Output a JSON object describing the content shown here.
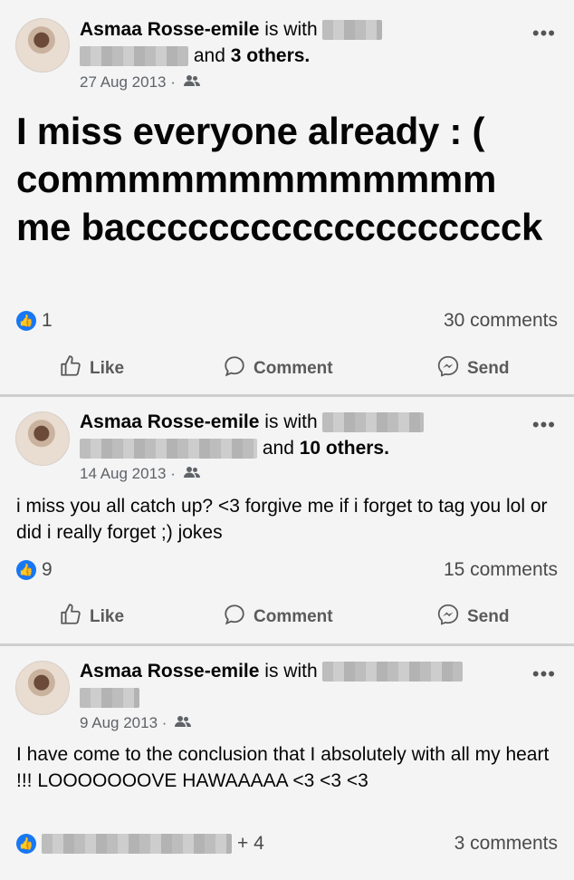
{
  "posts": [
    {
      "author": "Asmaa Rosse-emile",
      "with_text": "is with",
      "and_text": "and",
      "others": "3 others.",
      "date": "27 Aug 2013",
      "text": "I miss everyone already : ( commmmmmmmmmmmm me baccccccccccccccccccck",
      "likes": "1",
      "comments": "30 comments"
    },
    {
      "author": "Asmaa Rosse-emile",
      "with_text": "is with",
      "and_text": "and",
      "others": "10 others.",
      "date": "14 Aug 2013",
      "text": "i miss you all catch up? <3 forgive me if i forget to tag you lol or did i really forget ;) jokes",
      "likes": "9",
      "comments": "15 comments"
    },
    {
      "author": "Asmaa Rosse-emile",
      "with_text": "is with",
      "date": "9 Aug 2013",
      "text": "I have come to the conclusion that I absolutely with all my heart !!! LOOOOOOOVE HAWAAAAA <3 <3 <3",
      "likes_extra": "+ 4",
      "comments": "3 comments"
    }
  ],
  "actions": {
    "like": "Like",
    "comment": "Comment",
    "send": "Send"
  },
  "more": "•••",
  "date_separator": " · ",
  "icons": {
    "like": "thumbs-up-icon",
    "comment": "comment-icon",
    "send": "messenger-icon",
    "audience": "friends-icon"
  },
  "colors": {
    "accent": "#1877f2"
  }
}
